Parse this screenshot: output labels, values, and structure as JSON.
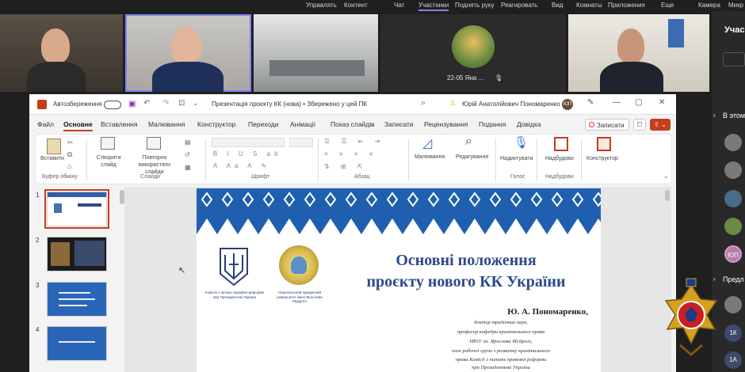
{
  "teams": {
    "menu": [
      "Управлять",
      "Контент",
      "Чат",
      "Участники",
      "Поднять руку",
      "Реагировать",
      "Вид",
      "Комнаты",
      "Приложения",
      "Еще",
      "Камера",
      "Микр"
    ],
    "active_index": 3,
    "panel_title": "Учас",
    "section_in_meeting": "В этом",
    "section_invited": "Предл",
    "avatars": [
      {
        "initials": "",
        "color": "#7a7a7a"
      },
      {
        "initials": "",
        "color": "#7a7a7a"
      },
      {
        "initials": "",
        "color": "#4a6b8a"
      },
      {
        "initials": "",
        "color": "#6a8a4a"
      },
      {
        "initials": "ЮП",
        "color": "#b87aa8"
      },
      {
        "initials": "",
        "color": "#7a7a7a"
      },
      {
        "initials": "1К",
        "color": "#3d4a6a"
      },
      {
        "initials": "1А",
        "color": "#3d4a6a"
      }
    ],
    "participant_name": "22-05 Яна ..."
  },
  "ppt": {
    "autosave": "Автозбереження",
    "doc_title": "Презентація проєкту КК (нова) • Збережено у цей ПК",
    "user": "Юрій Анатолійович Пономаренко",
    "user_initials": "ЮП",
    "tabs": [
      "Файл",
      "Основне",
      "Вставлення",
      "Малювання",
      "Конструктор",
      "Переходи",
      "Анімації",
      "Показ слайдів",
      "Записати",
      "Рецензування",
      "Подання",
      "Довідка"
    ],
    "active_tab": "Основне",
    "record_button": "Записати",
    "ribbon": {
      "paste": "Вставити",
      "new_slide": "Створити слайд",
      "reuse": "Повторно використати слайди",
      "drawing": "Малювання",
      "editing": "Редагування",
      "dictate": "Надиктувати",
      "addins": "Надбудови",
      "designer": "Конструктор",
      "groups": [
        "Буфер обміну",
        "Слайди",
        "Шрифт",
        "Абзац",
        "Голос",
        "Надбудови"
      ]
    },
    "slide_numbers": [
      "1",
      "2",
      "3",
      "4"
    ],
    "slide": {
      "title_line1": "Основні положення",
      "title_line2": "проєкту нового КК України",
      "logo1_caption": "Комісія з питань правової реформи при Президентові України",
      "logo2_caption": "Національний юридичний університет імені Ярослава Мудрого",
      "author": "Ю. А. Пономаренко,",
      "affiliation": [
        "доктор юридичних наук,",
        "професор кафедри кримінального права",
        "НЮУ ім. Ярослава Мудрого,",
        "член робочої групи з розвитку кримінального",
        "права Комісії з питань правової реформи",
        "при Президентові України"
      ]
    }
  },
  "colors": {
    "accent_teams": "#7f85f5",
    "ppt_accent": "#c43e1c",
    "slide_title": "#2c4a8c",
    "ornament": "#1f5fb0"
  }
}
